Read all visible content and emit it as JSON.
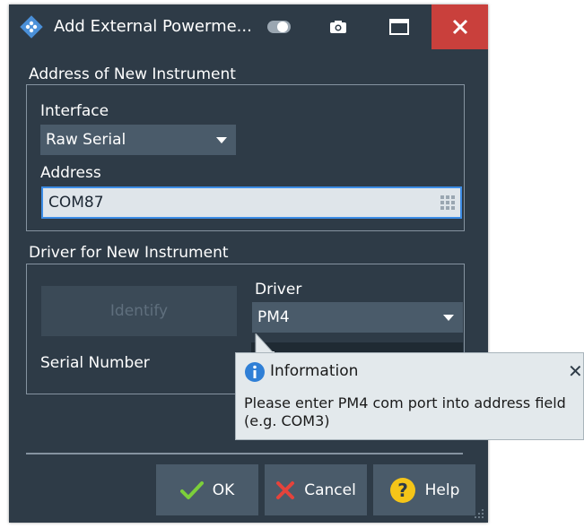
{
  "window": {
    "title": "Add External Powerme...",
    "buttons": [
      "toggle-icon",
      "camera-icon",
      "maximize-icon",
      "close-icon"
    ]
  },
  "address_group": {
    "label": "Address of New Instrument",
    "interface_label": "Interface",
    "interface_value": "Raw Serial",
    "address_label": "Address",
    "address_value": "COM87"
  },
  "driver_group": {
    "label": "Driver for New Instrument",
    "identify_label": "Identify",
    "driver_label": "Driver",
    "driver_value": "PM4",
    "serial_label": "Serial Number"
  },
  "tooltip": {
    "title": "Information",
    "line1": "Please enter PM4 com port into address field",
    "line2": "(e.g. COM3)"
  },
  "footer": {
    "ok_label": "OK",
    "cancel_label": "Cancel",
    "help_label": "Help"
  },
  "colors": {
    "dialog_bg": "#2e3b47",
    "control_bg": "#4a5b6a",
    "close_red": "#c9403c",
    "focus_blue": "#3d8de6",
    "ok_green": "#7ccf3a",
    "cancel_red": "#e5433b",
    "help_yellow": "#f5c518"
  }
}
